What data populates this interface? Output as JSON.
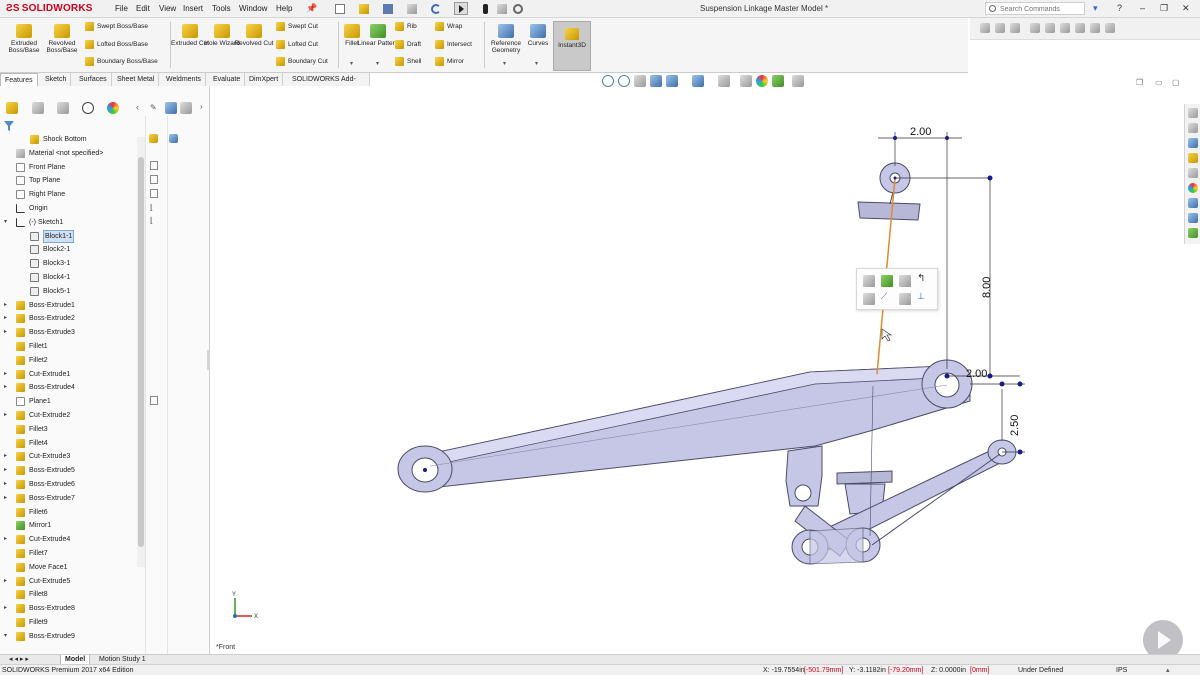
{
  "app": {
    "logo": "SOLIDWORKS",
    "document_title": "Suspension Linkage Master Model *"
  },
  "menu": [
    "File",
    "Edit",
    "View",
    "Insert",
    "Tools",
    "Window",
    "Help"
  ],
  "search": {
    "placeholder": "Search Commands"
  },
  "window_controls": {
    "help": "?",
    "minimize": "–",
    "restore": "❐",
    "close": "✕"
  },
  "ribbon": {
    "extruded_boss": "Extruded Boss/Base",
    "revolved_boss": "Revolved Boss/Base",
    "swept_boss": "Swept Boss/Base",
    "lofted_boss": "Lofted Boss/Base",
    "boundary_boss": "Boundary Boss/Base",
    "extruded_cut": "Extruded Cut",
    "hole_wizard": "Hole Wizard",
    "revolved_cut": "Revolved Cut",
    "swept_cut": "Swept Cut",
    "lofted_cut": "Lofted Cut",
    "boundary_cut": "Boundary Cut",
    "fillet": "Fillet",
    "linear_pattern": "Linear Pattern",
    "rib": "Rib",
    "draft": "Draft",
    "shell": "Shell",
    "wrap": "Wrap",
    "intersect": "Intersect",
    "mirror": "Mirror",
    "reference_geometry": "Reference Geometry",
    "curves": "Curves",
    "instant3d": "Instant3D"
  },
  "tabs": [
    "Features",
    "Sketch",
    "Surfaces",
    "Sheet Metal",
    "Weldments",
    "Evaluate",
    "DimXpert",
    "SOLIDWORKS Add-Ins"
  ],
  "tree": [
    {
      "label": "Shock Bottom",
      "icon": "part-icon",
      "indent": 1
    },
    {
      "label": "Material <not specified>",
      "icon": "material-icon",
      "indent": 0
    },
    {
      "label": "Front Plane",
      "icon": "plane-icon",
      "indent": 0
    },
    {
      "label": "Top Plane",
      "icon": "plane-icon",
      "indent": 0
    },
    {
      "label": "Right Plane",
      "icon": "plane-icon",
      "indent": 0
    },
    {
      "label": "Origin",
      "icon": "origin-icon",
      "indent": 0
    },
    {
      "label": "(-) Sketch1",
      "icon": "sketch-icon",
      "indent": 0,
      "caret": "▾"
    },
    {
      "label": "Block1-1",
      "icon": "block-icon",
      "indent": 1,
      "selected": true
    },
    {
      "label": "Block2-1",
      "icon": "block-icon",
      "indent": 1
    },
    {
      "label": "Block3-1",
      "icon": "block-icon",
      "indent": 1
    },
    {
      "label": "Block4-1",
      "icon": "block-icon",
      "indent": 1
    },
    {
      "label": "Block5-1",
      "icon": "block-icon",
      "indent": 1
    },
    {
      "label": "Boss-Extrude1",
      "icon": "extrude-icon",
      "indent": 0,
      "caret": "▸"
    },
    {
      "label": "Boss-Extrude2",
      "icon": "extrude-icon",
      "indent": 0,
      "caret": "▸"
    },
    {
      "label": "Boss-Extrude3",
      "icon": "extrude-icon",
      "indent": 0,
      "caret": "▸"
    },
    {
      "label": "Fillet1",
      "icon": "fillet-icon",
      "indent": 0
    },
    {
      "label": "Fillet2",
      "icon": "fillet-icon",
      "indent": 0
    },
    {
      "label": "Cut-Extrude1",
      "icon": "cut-icon",
      "indent": 0,
      "caret": "▸"
    },
    {
      "label": "Boss-Extrude4",
      "icon": "extrude-icon",
      "indent": 0,
      "caret": "▸"
    },
    {
      "label": "Plane1",
      "icon": "plane-icon",
      "indent": 0
    },
    {
      "label": "Cut-Extrude2",
      "icon": "cut-icon",
      "indent": 0,
      "caret": "▸"
    },
    {
      "label": "Fillet3",
      "icon": "fillet-icon",
      "indent": 0
    },
    {
      "label": "Fillet4",
      "icon": "fillet-icon",
      "indent": 0
    },
    {
      "label": "Cut-Extrude3",
      "icon": "cut-icon",
      "indent": 0,
      "caret": "▸"
    },
    {
      "label": "Boss-Extrude5",
      "icon": "extrude-icon",
      "indent": 0,
      "caret": "▸"
    },
    {
      "label": "Boss-Extrude6",
      "icon": "extrude-icon",
      "indent": 0,
      "caret": "▸"
    },
    {
      "label": "Boss-Extrude7",
      "icon": "extrude-icon",
      "indent": 0,
      "caret": "▸"
    },
    {
      "label": "Fillet6",
      "icon": "fillet-icon",
      "indent": 0
    },
    {
      "label": "Mirror1",
      "icon": "mirror-icon",
      "indent": 0
    },
    {
      "label": "Cut-Extrude4",
      "icon": "cut-icon",
      "indent": 0,
      "caret": "▸"
    },
    {
      "label": "Fillet7",
      "icon": "fillet-icon",
      "indent": 0
    },
    {
      "label": "Move Face1",
      "icon": "move-face-icon",
      "indent": 0
    },
    {
      "label": "Cut-Extrude5",
      "icon": "cut-icon",
      "indent": 0,
      "caret": "▸"
    },
    {
      "label": "Fillet8",
      "icon": "fillet-icon",
      "indent": 0
    },
    {
      "label": "Boss-Extrude8",
      "icon": "extrude-icon",
      "indent": 0,
      "caret": "▸"
    },
    {
      "label": "Fillet9",
      "icon": "fillet-icon",
      "indent": 0
    },
    {
      "label": "Boss-Extrude9",
      "icon": "extrude-icon",
      "indent": 0,
      "caret": "▾"
    }
  ],
  "dimensions": {
    "top": "2.00",
    "vertical": "8.00",
    "right_horizontal": "2.00",
    "right_vertical": "2.50"
  },
  "view": {
    "orientation": "*Front"
  },
  "bottom_tabs": [
    "Model",
    "Motion Study 1"
  ],
  "status": {
    "edition": "SOLIDWORKS Premium 2017 x64 Edition",
    "x": "X: -19.7554in",
    "x_mm": "[-501.79mm]",
    "y": "Y: -3.1182in",
    "y_mm": "[-79.20mm]",
    "z": "Z: 0.0000in",
    "z_mm": "[0mm]",
    "definition": "Under Defined",
    "units": "IPS"
  },
  "colors": {
    "accent": "#d0001b",
    "part_fill": "#c9c9e6",
    "part_edge": "#555577",
    "sketch_line": "#e08b2f",
    "dim_point": "#1a1a8c"
  }
}
